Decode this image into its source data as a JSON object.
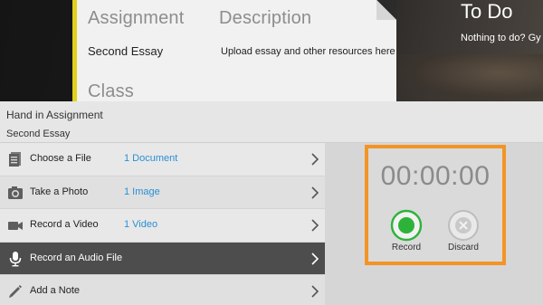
{
  "background": {
    "card": {
      "assignment_header": "Assignment",
      "assignment_value": "Second Essay",
      "description_header": "Description",
      "description_value": "Upload essay and other resources here",
      "class_header": "Class"
    },
    "todo": {
      "title": "To Do",
      "subtitle": "Nothing to do? Gy"
    }
  },
  "panel": {
    "title": "Hand in Assignment",
    "subtitle": "Second Essay",
    "options": [
      {
        "label": "Choose a File",
        "count": "1 Document",
        "icon": "file-icon"
      },
      {
        "label": "Take a Photo",
        "count": "1 Image",
        "icon": "camera-icon"
      },
      {
        "label": "Record a Video",
        "count": "1 Video",
        "icon": "video-camera-icon"
      },
      {
        "label": "Record an Audio File",
        "count": "",
        "icon": "microphone-icon",
        "selected": true
      },
      {
        "label": "Add a Note",
        "count": "",
        "icon": "pencil-icon"
      }
    ]
  },
  "recorder": {
    "timer": "00:00:00",
    "record_label": "Record",
    "discard_label": "Discard"
  },
  "colors": {
    "accent_orange": "#f39425",
    "record_green": "#2db33a",
    "link_blue": "#2a8fd6",
    "card_stripe": "#e2d11b"
  }
}
